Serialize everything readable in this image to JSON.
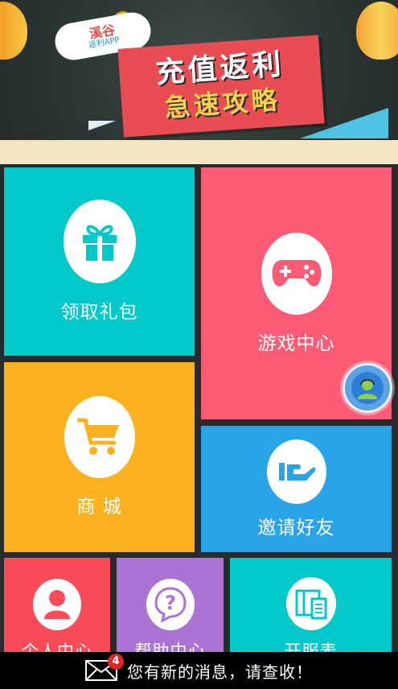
{
  "banner": {
    "logo_name": "溪谷",
    "logo_sub": "返利APP",
    "title_line1": "充值返利",
    "title_line2": "急速攻略"
  },
  "tiles": {
    "gift": {
      "label": "领取礼包",
      "icon": "gift-icon",
      "color": "#04c9cb"
    },
    "game": {
      "label": "游戏中心",
      "icon": "gamepad-icon",
      "color": "#fb5b75"
    },
    "shop": {
      "label": "商 城",
      "icon": "shopping-cart-icon",
      "color": "#fcb120"
    },
    "invite": {
      "label": "邀请好友",
      "icon": "hand-invite-icon",
      "color": "#29a4e7"
    },
    "profile": {
      "label": "个人中心",
      "icon": "user-icon",
      "color": "#fa4b58"
    },
    "help": {
      "label": "帮助中心",
      "icon": "question-icon",
      "color": "#ac72d4"
    },
    "server": {
      "label": "开服表",
      "icon": "server-list-icon",
      "color": "#04c9cb"
    }
  },
  "floating_service": {
    "icon": "customer-service-icon"
  },
  "message_bar": {
    "badge_count": "4",
    "text": "您有新的消息，请查收！",
    "icon": "envelope-icon"
  }
}
